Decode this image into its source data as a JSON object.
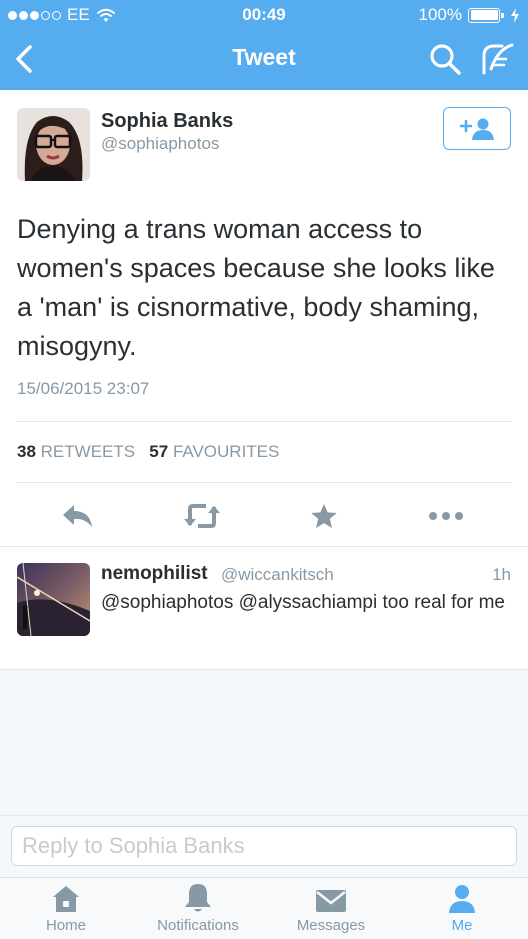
{
  "status_bar": {
    "carrier": "EE",
    "time": "00:49",
    "battery": "100%"
  },
  "nav": {
    "title": "Tweet"
  },
  "tweet": {
    "author_name": "Sophia Banks",
    "author_handle": "@sophiaphotos",
    "text": "Denying a trans woman access to women's spaces because she looks like a 'man' is cisnormative, body shaming, misogyny.",
    "timestamp": "15/06/2015 23:07",
    "retweets_count": "38",
    "retweets_label": "RETWEETS",
    "favourites_count": "57",
    "favourites_label": "FAVOURITES"
  },
  "reply": {
    "author_name": "nemophilist",
    "author_handle": "@wiccankitsch",
    "time_ago": "1h",
    "text": "@sophiaphotos @alyssachiampi too real for me"
  },
  "reply_input": {
    "placeholder": "Reply to Sophia Banks"
  },
  "tabs": [
    {
      "label": "Home",
      "icon": "home-icon"
    },
    {
      "label": "Notifications",
      "icon": "bell-icon"
    },
    {
      "label": "Messages",
      "icon": "envelope-icon"
    },
    {
      "label": "Me",
      "icon": "person-icon",
      "active": true
    }
  ],
  "colors": {
    "brand": "#55acee",
    "text": "#292f33",
    "muted": "#8899a6",
    "border": "#e1e8ed"
  }
}
